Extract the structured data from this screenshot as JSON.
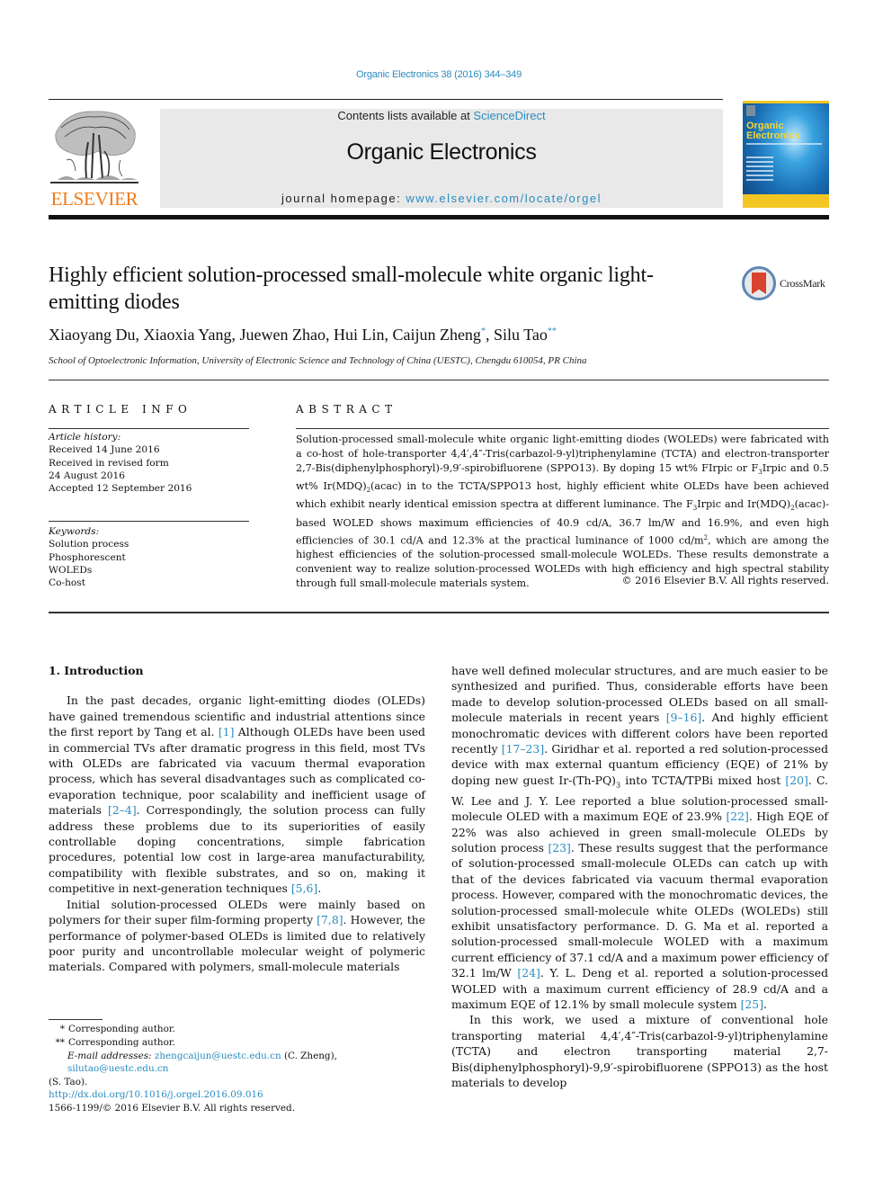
{
  "journal_ref": "Organic Electronics 38 (2016) 344–349",
  "header": {
    "publisher_logo": "ELSEVIER",
    "contents_prefix": "Contents lists available at ",
    "contents_link": "ScienceDirect",
    "journal_title": "Organic Electronics",
    "homepage_prefix": "journal homepage: ",
    "homepage_link": "www.elsevier.com/locate/orgel",
    "cover": {
      "title_line1": "Organic",
      "title_line2": "Electronics"
    }
  },
  "colors": {
    "link": "#2a8cbf",
    "elsevier_orange": "#f07a19",
    "header_box": "#e9e9e9",
    "cover_yellow": "#f4c623"
  },
  "article": {
    "title": "Highly efficient solution-processed small-molecule white organic light-emitting diodes",
    "crossmark_label": "CrossMark",
    "authors": [
      {
        "name": "Xiaoyang Du",
        "mark": ""
      },
      {
        "name": "Xiaoxia Yang",
        "mark": ""
      },
      {
        "name": "Juewen Zhao",
        "mark": ""
      },
      {
        "name": "Hui Lin",
        "mark": ""
      },
      {
        "name": "Caijun Zheng",
        "mark": "*"
      },
      {
        "name": "Silu Tao",
        "mark": "**"
      }
    ],
    "affiliation": "School of Optoelectronic Information, University of Electronic Science and Technology of China (UESTC), Chengdu 610054, PR China"
  },
  "article_info": {
    "heading": "ARTICLE INFO",
    "history_label": "Article history:",
    "history": [
      "Received 14 June 2016",
      "Received in revised form",
      "24 August 2016",
      "Accepted 12 September 2016"
    ],
    "keywords_label": "Keywords:",
    "keywords": [
      "Solution process",
      "Phosphorescent",
      "WOLEDs",
      "Co-host"
    ]
  },
  "abstract": {
    "heading": "ABSTRACT",
    "p1": "Solution-processed small-molecule white organic light-emitting diodes (WOLEDs) were fabricated with a co-host of hole-transporter 4,4′,4″-Tris(carbazol-9-yl)triphenylamine (TCTA) and electron-transporter 2,7-Bis(diphenylphosphoryl)-9,9′-spirobifluorene (SPPO13). By doping 15 wt% FIrpic or F",
    "p1_sub1": "3",
    "p2": "Irpic and 0.5 wt% Ir(MDQ)",
    "p2_sub": "2",
    "p3": "(acac) in to the TCTA/SPPO13 host, highly efficient white OLEDs have been achieved which exhibit nearly identical emission spectra at different luminance. The F",
    "p3_sub": "3",
    "p4": "Irpic and Ir(MDQ)",
    "p4_sub": "2",
    "p5": "(acac)-based WOLED shows maximum efficiencies of 40.9 cd/A, 36.7 lm/W and 16.9%, and even high efficiencies of 30.1 cd/A and 12.3% at the practical luminance of 1000 cd/m",
    "p5_sup": "2",
    "p6": ", which are among the highest efficiencies of the solution-processed small-molecule WOLEDs. These results demonstrate a convenient way to realize solution-processed WOLEDs with high efficiency and high spectral stability through full small-molecule materials system.",
    "copyright": "© 2016 Elsevier B.V. All rights reserved."
  },
  "body": {
    "section_heading": "1.  Introduction",
    "left": {
      "para1": [
        {
          "t": "In the past decades, organic light-emitting diodes (OLEDs) have gained tremendous scientific and industrial attentions since the first report by Tang et al. "
        },
        {
          "ref": "[1]"
        },
        {
          "t": " Although OLEDs have been used in commercial TVs after dramatic progress in this field, most TVs with OLEDs are fabricated via vacuum thermal evaporation process, which has several disadvantages such as complicated co-evaporation technique, poor scalability and inefficient usage of materials "
        },
        {
          "ref": "[2–4]"
        },
        {
          "t": ". Correspondingly, the solution process can fully address these problems due to its superiorities of easily controllable doping concentrations, simple fabrication procedures, potential low cost in large-area manufacturability, compatibility with flexible substrates, and so on, making it competitive in next-generation techniques "
        },
        {
          "ref": "[5,6]"
        },
        {
          "t": "."
        }
      ],
      "para2": [
        {
          "t": "Initial solution-processed OLEDs were mainly based on polymers for their super film-forming property "
        },
        {
          "ref": "[7,8]"
        },
        {
          "t": ". However, the performance of polymer-based OLEDs is limited due to relatively poor purity and uncontrollable molecular weight of polymeric materials. Compared with polymers, small-molecule materials"
        }
      ]
    },
    "right": {
      "para1": [
        {
          "t": "have well defined molecular structures, and are much easier to be synthesized and purified. Thus, considerable efforts have been made to develop solution-processed OLEDs based on all small-molecule materials in recent years "
        },
        {
          "ref": "[9–16]"
        },
        {
          "t": ". And highly efficient monochromatic devices with different colors have been reported recently "
        },
        {
          "ref": "[17–23]"
        },
        {
          "t": ". Giridhar et al. reported a red solution-processed device with max external quantum efficiency (EQE) of 21% by doping new guest Ir-(Th-PQ)"
        },
        {
          "sub": "3"
        },
        {
          "t": " into TCTA/TPBi mixed host "
        },
        {
          "ref": "[20]"
        },
        {
          "t": ". C. W. Lee and J. Y. Lee reported a blue solution-processed small-molecule OLED with a maximum EQE of 23.9% "
        },
        {
          "ref": "[22]"
        },
        {
          "t": ". High EQE of 22% was also achieved in green small-molecule OLEDs by solution process "
        },
        {
          "ref": "[23]"
        },
        {
          "t": ". These results suggest that the performance of solution-processed small-molecule OLEDs can catch up with that of the devices fabricated via vacuum thermal evaporation process. However, compared with the monochromatic devices, the solution-processed small-molecule white OLEDs (WOLEDs) still exhibit unsatisfactory performance. D. G. Ma et al. reported a solution-processed small-molecule WOLED with a maximum current efficiency of 37.1 cd/A and a maximum power efficiency of 32.1 lm/W "
        },
        {
          "ref": "[24]"
        },
        {
          "t": ". Y. L. Deng et al. reported a solution-processed WOLED with a maximum current efficiency of 28.9 cd/A and a maximum EQE of 12.1% by small molecule system "
        },
        {
          "ref": "[25]"
        },
        {
          "t": "."
        }
      ],
      "para2": [
        {
          "t": "In this work, we used a mixture of conventional hole transporting material 4,4′,4″-Tris(carbazol-9-yl)triphenylamine (TCTA) and electron transporting material 2,7-Bis(diphenylphosphoryl)-9,9′-spirobifluorene (SPPO13) as the host materials to develop"
        }
      ]
    }
  },
  "footnotes": {
    "fn1_mark": "*",
    "fn1_text": "Corresponding author.",
    "fn2_mark": "**",
    "fn2_text": "Corresponding author.",
    "email_label": "E-mail addresses:",
    "email1": "zhengcaijun@uestc.edu.cn",
    "email1_who": " (C. Zheng), ",
    "email2": "silutao@uestc.edu.cn",
    "email2_who": "(S. Tao).",
    "doi": "http://dx.doi.org/10.1016/j.orgel.2016.09.016",
    "issn": "1566-1199/© 2016 Elsevier B.V. All rights reserved."
  }
}
